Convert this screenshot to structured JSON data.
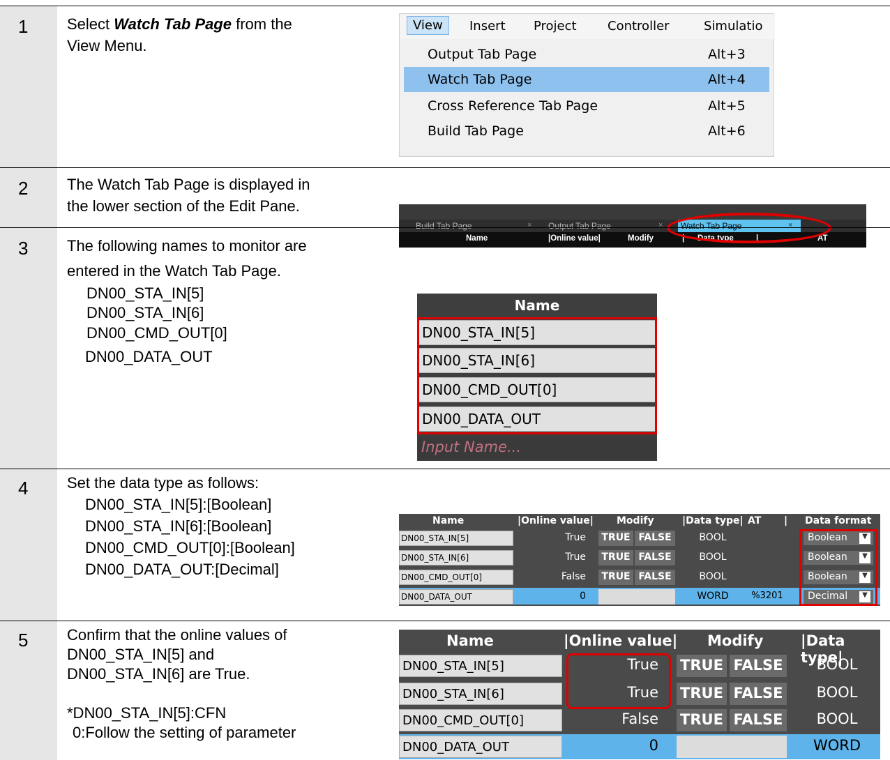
{
  "steps": [
    {
      "number": "1",
      "lines": [
        "Select ",
        "Watch Tab Page",
        " from the",
        "View Menu."
      ]
    },
    {
      "number": "2",
      "lines": [
        "The Watch Tab Page is displayed in",
        "the lower section of the Edit Pane."
      ]
    },
    {
      "number": "3",
      "lines": [
        "The following names to monitor are",
        "entered in the Watch Tab Page.",
        "DN00_STA_IN[5]",
        "DN00_STA_IN[6]",
        "DN00_CMD_OUT[0]",
        "DN00_DATA_OUT"
      ]
    },
    {
      "number": "4",
      "lines": [
        "Set the data type as follows:",
        "DN00_STA_IN[5]:[Boolean]",
        "DN00_STA_IN[6]:[Boolean]",
        "DN00_CMD_OUT[0]:[Boolean]",
        "DN00_DATA_OUT:[Decimal]"
      ]
    },
    {
      "number": "5",
      "lines": [
        "Confirm that the online values of",
        "DN00_STA_IN[5] and",
        "DN00_STA_IN[6] are True.",
        "",
        "*DN00_STA_IN[5]:CFN",
        "0:Follow the setting of parameter"
      ]
    }
  ],
  "menu": {
    "bar": [
      "View",
      "Insert",
      "Project",
      "Controller",
      "Simulatio"
    ],
    "items": [
      {
        "label": "Output Tab Page",
        "key": "Alt+3"
      },
      {
        "label": "Watch Tab Page",
        "key": "Alt+4"
      },
      {
        "label": "Cross Reference Tab Page",
        "key": "Alt+5"
      },
      {
        "label": "Build Tab Page",
        "key": "Alt+6"
      }
    ],
    "selected_index": 1
  },
  "tabbar": {
    "tabs": [
      "Build Tab Page",
      "Output Tab Page",
      "Watch Tab Page"
    ],
    "close": "×",
    "columns": [
      "Name",
      "|Online value|",
      "Modify",
      "|",
      "Data type",
      "|",
      "AT"
    ]
  },
  "names_panel": {
    "header": "Name",
    "names": [
      "DN00_STA_IN[5]",
      "DN00_STA_IN[6]",
      "DN00_CMD_OUT[0]",
      "DN00_DATA_OUT"
    ],
    "placeholder": "Input Name..."
  },
  "watch_table_4": {
    "headers": [
      "Name",
      "|Online value|",
      "Modify",
      "|Data type|",
      "AT",
      "|",
      "Data format"
    ],
    "rows": [
      {
        "name": "DN00_STA_IN[5]",
        "value": "True",
        "true_btn": "TRUE",
        "false_btn": "FALSE",
        "type": "BOOL",
        "at": "",
        "format": "Boolean"
      },
      {
        "name": "DN00_STA_IN[6]",
        "value": "True",
        "true_btn": "TRUE",
        "false_btn": "FALSE",
        "type": "BOOL",
        "at": "",
        "format": "Boolean"
      },
      {
        "name": "DN00_CMD_OUT[0]",
        "value": "False",
        "true_btn": "TRUE",
        "false_btn": "FALSE",
        "type": "BOOL",
        "at": "",
        "format": "Boolean"
      },
      {
        "name": "DN00_DATA_OUT",
        "value": "0",
        "true_btn": "",
        "false_btn": "",
        "type": "WORD",
        "at": "%3201",
        "format": "Decimal"
      }
    ],
    "dropdown_arrow": "▼"
  },
  "watch_table_5": {
    "headers": [
      "Name",
      "|Online value|",
      "Modify",
      "|Data type|"
    ],
    "rows": [
      {
        "name": "DN00_STA_IN[5]",
        "value": "True",
        "true_btn": "TRUE",
        "false_btn": "FALSE",
        "type": "BOOL"
      },
      {
        "name": "DN00_STA_IN[6]",
        "value": "True",
        "true_btn": "TRUE",
        "false_btn": "FALSE",
        "type": "BOOL"
      },
      {
        "name": "DN00_CMD_OUT[0]",
        "value": "False",
        "true_btn": "TRUE",
        "false_btn": "FALSE",
        "type": "BOOL"
      },
      {
        "name": "DN00_DATA_OUT",
        "value": "0",
        "true_btn": "",
        "false_btn": "",
        "type": "WORD"
      }
    ]
  },
  "colors": {
    "highlight_red": "#e00000",
    "menu_selected": "#8ec1ee",
    "tab_active": "#5fc3f0",
    "blue_band": "#5eb4ea"
  }
}
